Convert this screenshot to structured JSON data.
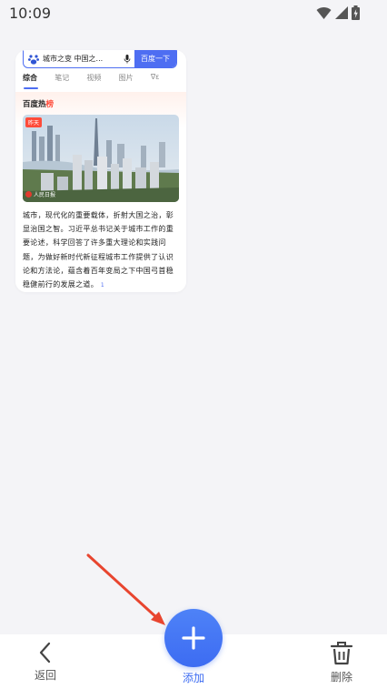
{
  "status_bar": {
    "time": "10:09",
    "icons": [
      "wifi-icon",
      "signal-icon",
      "battery-charging-icon"
    ]
  },
  "tab_card": {
    "search": {
      "query": "城市之变 中国之...",
      "button_label": "百度一下"
    },
    "tabs": [
      {
        "label": "综合",
        "active": true
      },
      {
        "label": "笔记",
        "active": false
      },
      {
        "label": "视频",
        "active": false
      },
      {
        "label": "图片",
        "active": false
      },
      {
        "label": "∇ε",
        "active": false
      }
    ],
    "hot_title_prefix": "百度热",
    "hot_title_suffix": "榜",
    "news": {
      "badge": "昨天",
      "source": "人民日报",
      "body": "城市，现代化的重要载体，折射大国之治，彰显治国之智。习近平总书记关于城市工作的重要论述，科学回答了许多重大理论和实践问题，为做好新时代新征程城市工作提供了认识论和方法论，蕴含着百年变局之下中国弓首稳稳健前行的发展之道。",
      "ref": "1"
    }
  },
  "toolbar": {
    "back_label": "返回",
    "add_label": "添加",
    "delete_label": "删除"
  },
  "colors": {
    "accent": "#3d6cf2",
    "annotation_arrow": "#e8452f",
    "background": "#f4f4f7"
  }
}
